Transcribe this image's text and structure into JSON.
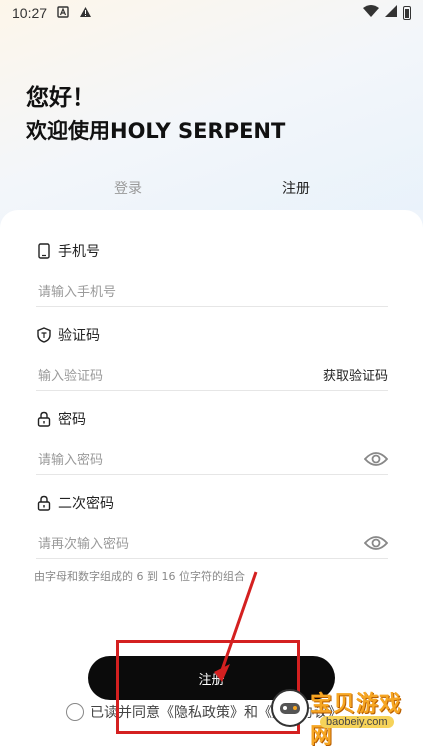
{
  "status_bar": {
    "time": "10:27"
  },
  "header": {
    "greeting": "您好！",
    "welcome": "欢迎使用HOLY SERPENT"
  },
  "tabs": {
    "login": "登录",
    "register": "注册"
  },
  "fields": {
    "phone": {
      "label": "手机号",
      "placeholder": "请输入手机号"
    },
    "code": {
      "label": "验证码",
      "placeholder": "输入验证码",
      "action": "获取验证码"
    },
    "password": {
      "label": "密码",
      "placeholder": "请输入密码"
    },
    "confirm": {
      "label": "二次密码",
      "placeholder": "请再次输入密码"
    }
  },
  "hint": "由字母和数字组成的 6 到 16 位字符的组合",
  "register_button": "注册",
  "agreement": {
    "text": "已读并同意《隐私政策》和《用户协议》"
  },
  "watermark": {
    "name": "宝贝游戏网",
    "url": "baobeiy.com"
  },
  "colors": {
    "annotation": "#d42020",
    "button": "#0b0b0b",
    "watermark": "#f6a623"
  }
}
